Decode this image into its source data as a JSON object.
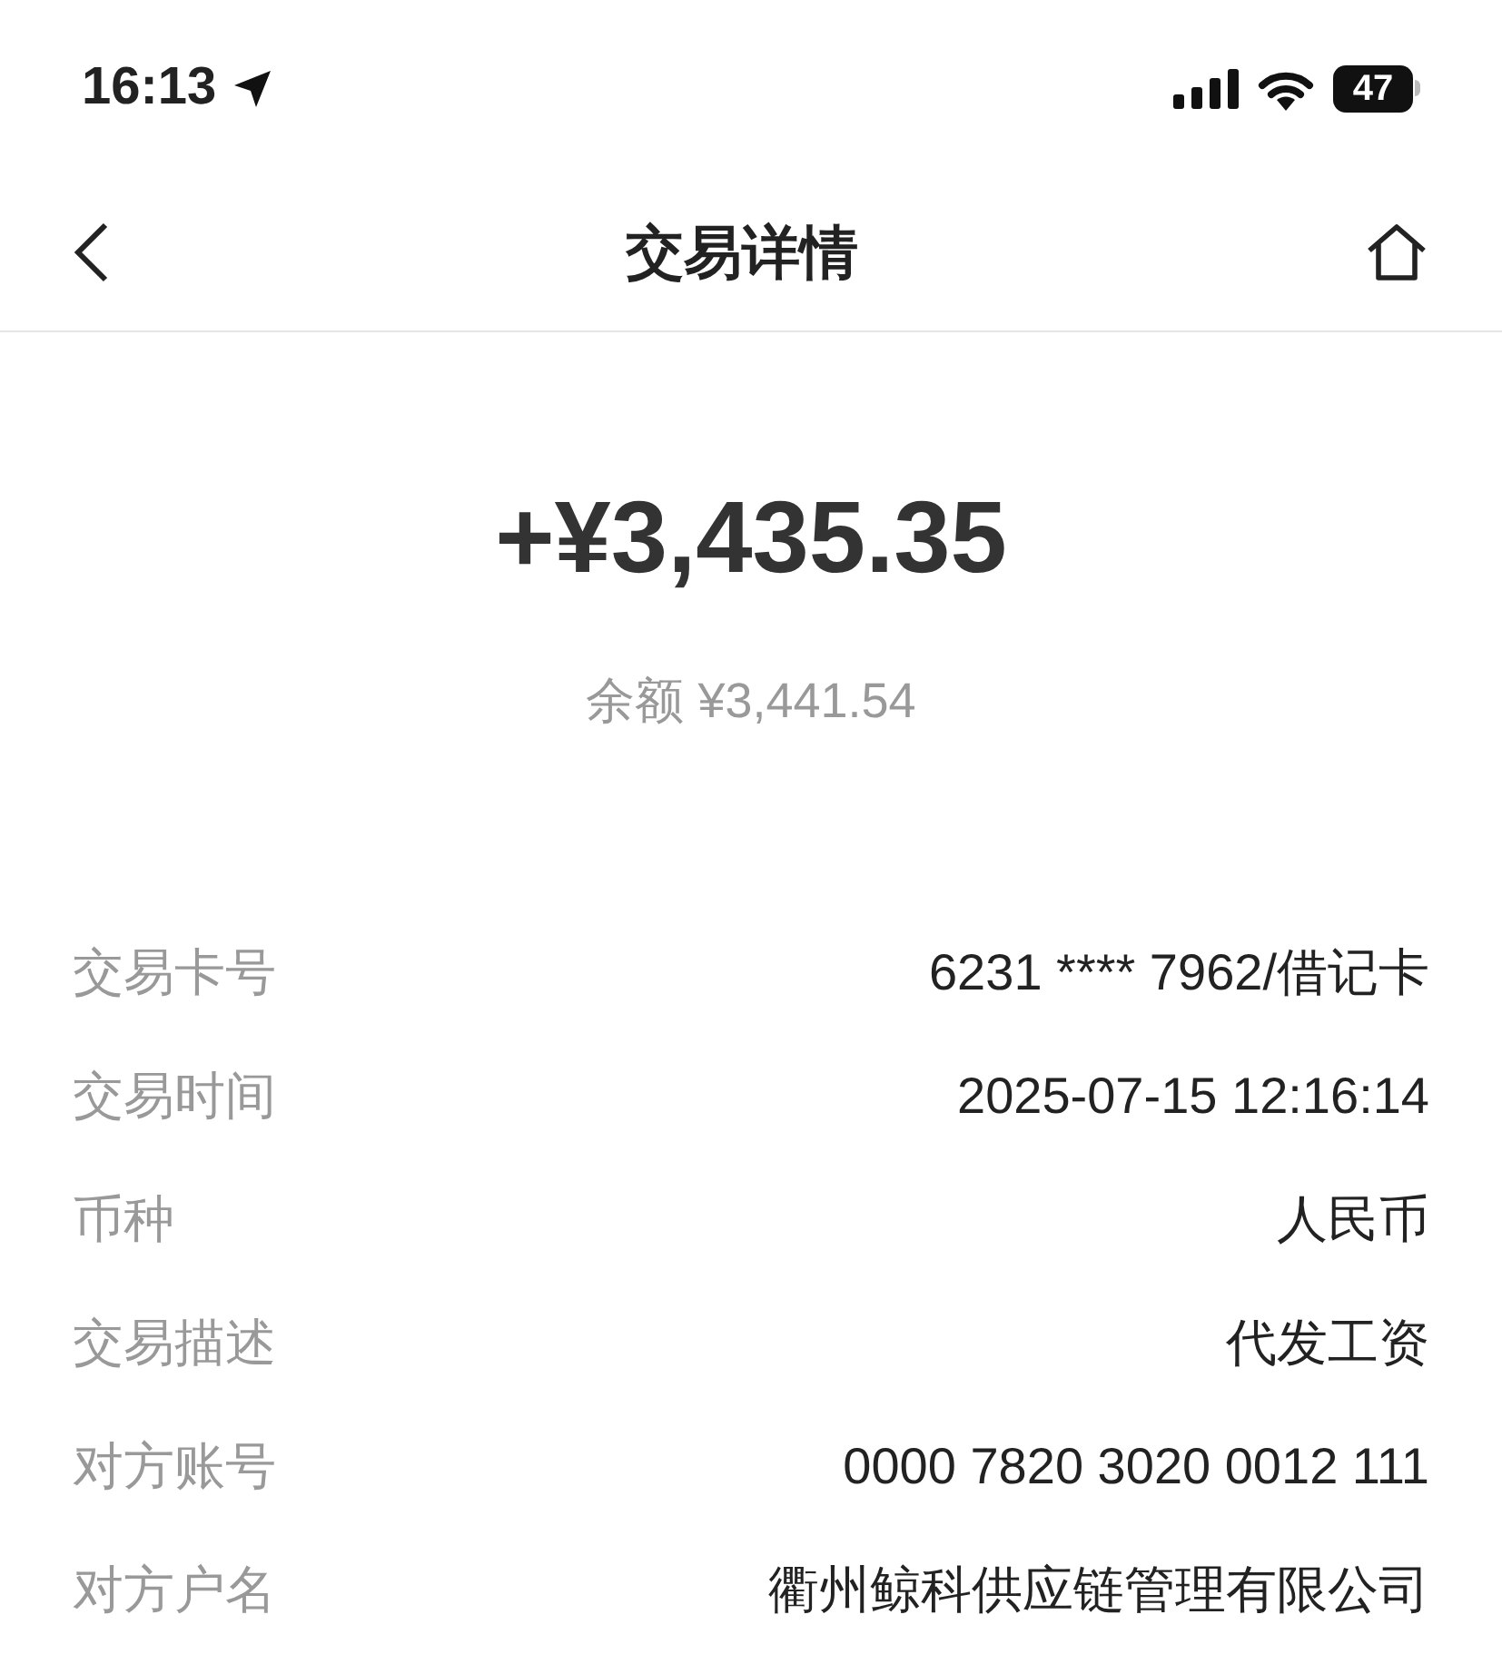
{
  "status_bar": {
    "time": "16:13",
    "battery": "47"
  },
  "nav": {
    "title": "交易详情"
  },
  "amount": "+¥3,435.35",
  "balance": "余额 ¥3,441.54",
  "details": [
    {
      "label": "交易卡号",
      "value": "6231 **** 7962/借记卡"
    },
    {
      "label": "交易时间",
      "value": "2025-07-15 12:16:14"
    },
    {
      "label": "币种",
      "value": "人民币"
    },
    {
      "label": "交易描述",
      "value": "代发工资"
    },
    {
      "label": "对方账号",
      "value": "0000 7820 3020 0012 111"
    },
    {
      "label": "对方户名",
      "value": "衢州鲸科供应链管理有限公司"
    }
  ]
}
